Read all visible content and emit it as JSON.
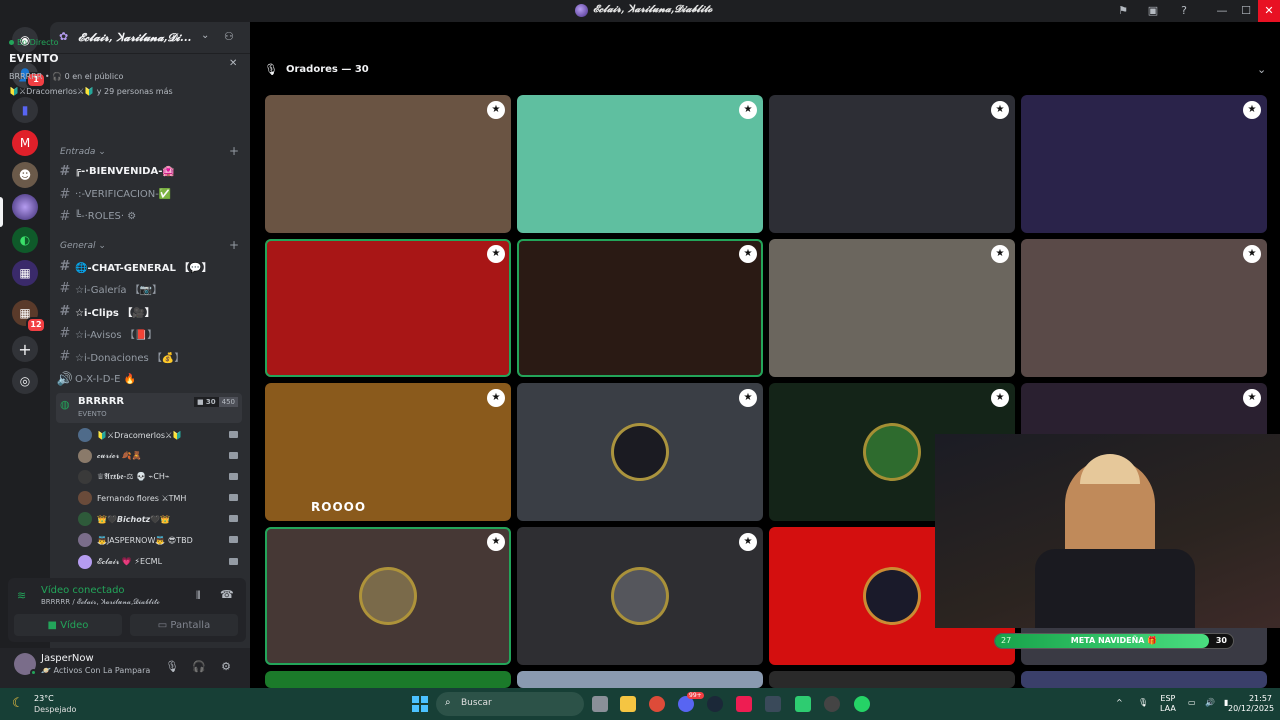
{
  "window": {
    "title": "𝓔𝓬𝓵𝓪𝓲𝓻, ꓘ𝓪𝓻𝓲𝓵𝓾𝓷𝓪,𝓓𝓲𝓪𝓫𝓵𝓲𝓽𝓸"
  },
  "rail": {
    "badges": [
      "1",
      "12"
    ]
  },
  "server": {
    "name": "𝓔𝓬𝓵𝓪𝓲𝓻, ꓘ𝓪𝓻𝓲𝓵𝓾𝓷𝓪,𝓓𝓲...",
    "event": {
      "live_label": "En Directo",
      "title": "EVENTO",
      "subtitle": "BRRRRR • 🎧 0 en el público",
      "people": "🔰⚔Dracomerlos⚔🔰 y 29 personas más"
    }
  },
  "categories": [
    {
      "label": "Entrada ⌄"
    },
    {
      "label": "General ⌄"
    }
  ],
  "channels": [
    {
      "label": "╔-·BIENVENIDA-🏩",
      "bold": true
    },
    {
      "label": "·:-VERIFICACION-✅",
      "bold": false
    },
    {
      "label": "╚-·ROLES· ⚙",
      "bold": false
    },
    {
      "label": "🌐-CHAT-GENERAL 【💬】",
      "bold": true
    },
    {
      "label": "☆i-Galería 【📷】",
      "bold": false
    },
    {
      "label": "☆i-Clips 【🎥】",
      "bold": true
    },
    {
      "label": "☆i-Avisos 【📕】",
      "bold": false
    },
    {
      "label": "☆i-Donaciones 【💰】",
      "bold": false
    },
    {
      "label": "O-X-I-D-E 🔥",
      "bold": false
    }
  ],
  "voice_channel": {
    "name": "BRRRRR",
    "subtitle": "EVENTO",
    "video_count": "30",
    "limit": "450"
  },
  "voice_users": [
    {
      "name": "🔰⚔Dracomerlos⚔🔰",
      "color": "#4f6b8a"
    },
    {
      "name": "𝓬𝓾𝓻𝓲𝓸𝓻 🍂🧸",
      "color": "#8a7a6a"
    },
    {
      "name": "♕𝕬𝖗𝖝𝖇𝖊-⚖ 💀 ⌁CH⌁",
      "color": "#3a3a3a"
    },
    {
      "name": "Fernando flores ⚔TMH",
      "color": "#6a4b3a"
    },
    {
      "name": "👑🖤𝘽𝙞𝙘𝙝𝙤𝙩𝙯🖤👑",
      "color": "#2e5a3a"
    },
    {
      "name": "👼JASPERNOW👼 😎TBD",
      "color": "#7a6d8a"
    },
    {
      "name": "𝓔𝓬𝓵𝓪𝓲𝓻 💗 ⚡ECML",
      "color": "#b59cf0"
    }
  ],
  "voice_panel": {
    "title": "Vídeo conectado",
    "subtitle": "BRRRRR / 𝓔𝓬𝓵𝓪𝓲𝓻, ꓘ𝓪𝓻𝓲𝓵𝓾𝓷𝓪,𝓓𝓲𝓪𝓫𝓵𝓲𝓽𝓸",
    "video_label": "Vídeo",
    "screen_label": "Pantalla"
  },
  "user": {
    "name": "JasperNow",
    "status": "🪐 Activos Con La Pampara"
  },
  "stage": {
    "speakers_label": "Oradores — 30"
  },
  "tiles": [
    {
      "bg": "#6a5443",
      "speaking": false,
      "avatar": "",
      "caption": ""
    },
    {
      "bg": "#5fbfa0",
      "speaking": false,
      "avatar": "",
      "caption": ""
    },
    {
      "bg": "#2d2e35",
      "speaking": false,
      "avatar": "",
      "caption": ""
    },
    {
      "bg": "#2a234a",
      "speaking": false,
      "avatar": "",
      "caption": ""
    },
    {
      "bg": "#a81616",
      "speaking": true,
      "avatar": "",
      "caption": ""
    },
    {
      "bg": "#2a1a14",
      "speaking": true,
      "avatar": "",
      "caption": ""
    },
    {
      "bg": "#6b665e",
      "speaking": false,
      "avatar": "",
      "caption": ""
    },
    {
      "bg": "#5a4a48",
      "speaking": false,
      "avatar": "",
      "caption": ""
    },
    {
      "bg": "#8a5a1c",
      "speaking": false,
      "avatar": "",
      "caption": "ROOOO"
    },
    {
      "bg": "#3a3e45",
      "speaking": false,
      "avatar": "#1b1b22",
      "caption": ""
    },
    {
      "bg": "#142418",
      "speaking": false,
      "avatar": "#2e6b2e",
      "caption": ""
    },
    {
      "bg": "#2a2030",
      "speaking": false,
      "avatar": "",
      "caption": ""
    },
    {
      "bg": "#463835",
      "speaking": true,
      "avatar": "#7a6a4a",
      "caption": ""
    },
    {
      "bg": "#2e2e32",
      "speaking": false,
      "avatar": "#55565c",
      "caption": ""
    },
    {
      "bg": "#d40f0f",
      "speaking": false,
      "avatar": "#1a1a2a",
      "caption": ""
    },
    {
      "bg": "#3a3a44",
      "speaking": false,
      "avatar": "",
      "caption": ""
    }
  ],
  "overlay": {
    "goal_label": "META NAVIDEÑA 🎁",
    "goal_current": "27",
    "goal_target": "30",
    "goal_progress": 0.9
  },
  "taskbar": {
    "weather_temp": "23°C",
    "weather_desc": "Despejado",
    "search_placeholder": "Buscar",
    "lang_top": "ESP",
    "lang_bottom": "LAA",
    "time": "21:57",
    "date": "20/12/2025",
    "app_badge": "99+"
  }
}
